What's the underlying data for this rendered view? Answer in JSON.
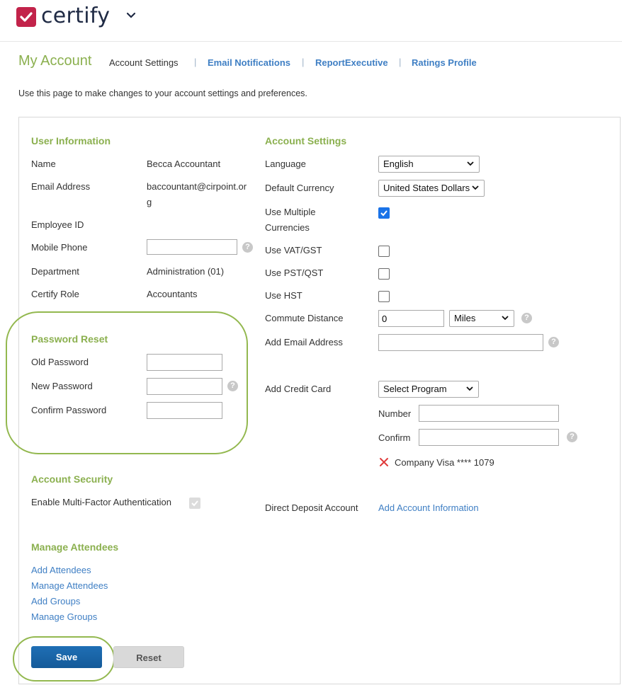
{
  "brand": {
    "name": "certify",
    "color": "#c2234a"
  },
  "nav": {
    "title": "My Account",
    "tabs": [
      "Account Settings",
      "Email Notifications",
      "ReportExecutive",
      "Ratings Profile"
    ],
    "separator": "|"
  },
  "intro": "Use this page to make changes to your account settings and preferences.",
  "user_info": {
    "heading": "User Information",
    "name_label": "Name",
    "name_value": "Becca Accountant",
    "email_label": "Email Address",
    "email_line1": "baccountant@cirpoint.or",
    "email_line2": "g",
    "employee_id_label": "Employee ID",
    "mobile_label": "Mobile Phone",
    "mobile_value": "",
    "department_label": "Department",
    "department_value": "Administration (01)",
    "role_label": "Certify Role",
    "role_value": "Accountants"
  },
  "password_reset": {
    "heading": "Password Reset",
    "old_label": "Old Password",
    "new_label": "New Password",
    "confirm_label": "Confirm Password"
  },
  "account_security": {
    "heading": "Account Security",
    "mfa_label": "Enable Multi-Factor Authentication",
    "mfa_checked": true
  },
  "manage_attendees": {
    "heading": "Manage Attendees",
    "links": [
      "Add Attendees",
      "Manage Attendees",
      "Add Groups",
      "Manage Groups"
    ]
  },
  "account_settings": {
    "heading": "Account Settings",
    "language_label": "Language",
    "language_value": "English",
    "currency_label": "Default Currency",
    "currency_value": "United States Dollars",
    "multi_currency_label_1": "Use Multiple",
    "multi_currency_label_2": "Currencies",
    "multi_currency_checked": true,
    "vat_label": "Use VAT/GST",
    "pst_label": "Use PST/QST",
    "hst_label": "Use HST",
    "commute_label": "Commute Distance",
    "commute_value": "0",
    "commute_unit": "Miles",
    "add_email_label": "Add Email Address",
    "add_email_value": "",
    "credit_card_label": "Add Credit Card",
    "program_value": "Select Program",
    "number_label": "Number",
    "confirm_label": "Confirm",
    "existing_card": "Company Visa **** 1079",
    "direct_deposit_label": "Direct Deposit Account",
    "direct_deposit_link": "Add Account Information"
  },
  "buttons": {
    "save": "Save",
    "reset": "Reset"
  },
  "help_glyph": "?",
  "colors": {
    "accent_green": "#8bb04f",
    "link_blue": "#3f7fc4",
    "save_blue": "#1a65a8",
    "remove_red": "#e03c3c"
  }
}
